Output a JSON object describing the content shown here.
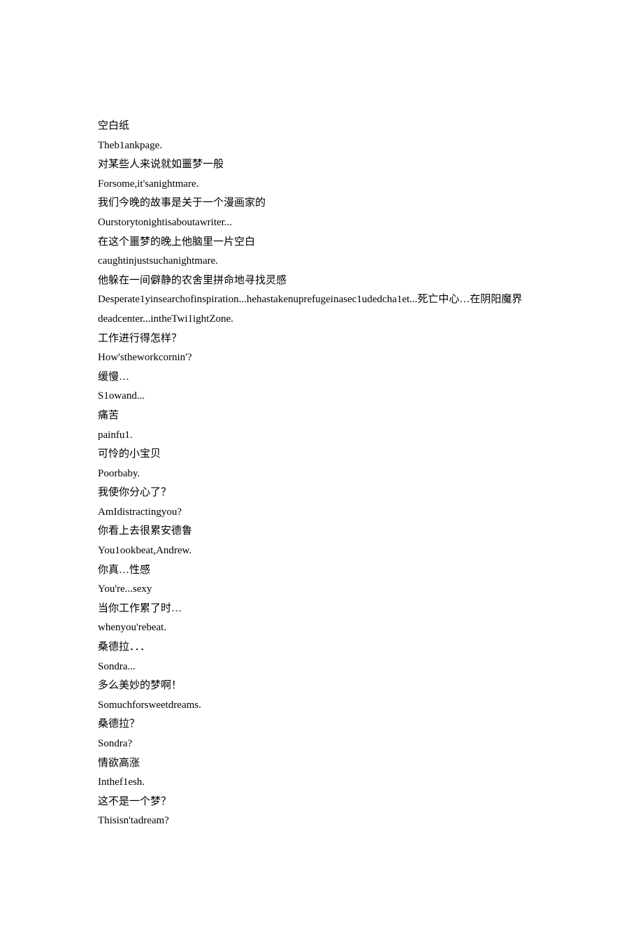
{
  "lines": [
    "空白纸",
    "Theb1ankpage.",
    "对某些人来说就如噩梦一般",
    "Forsome,it'sanightmare.",
    "我们今晚的故事是关于一个漫画家的",
    "Ourstorytonightisaboutawriter...",
    "在这个噩梦的晚上他脑里一片空白",
    "caughtinjustsuchanightmare.",
    "他躲在一间僻静的农舍里拼命地寻找灵感",
    "Desperate1yinsearchofinspiration...hehastakenuprefugeinasec1udedcha1et...死亡中心…在阴阳魔界",
    "deadcenter...intheTwi1ightZone.",
    "工作进行得怎样？",
    "How'stheworkcornin'?",
    "缓慢…",
    "S1owand...",
    "痛苦",
    "painfu1.",
    "可怜的小宝贝",
    "Poorbaby.",
    "我使你分心了？",
    "AmIdistractingyou?",
    "你看上去很累安德鲁",
    "You1ookbeat,Andrew.",
    "你真…性感",
    "You're...sexy",
    "当你工作累了时…",
    "whenyou'rebeat.",
    "桑德拉．．．",
    "Sondra...",
    "多么美妙的梦啊！",
    "Somuchforsweetdreams.",
    "桑德拉？",
    "Sondra?",
    "情欲高涨",
    "Inthef1esh.",
    "这不是一个梦？",
    "Thisisn'tadream?"
  ]
}
